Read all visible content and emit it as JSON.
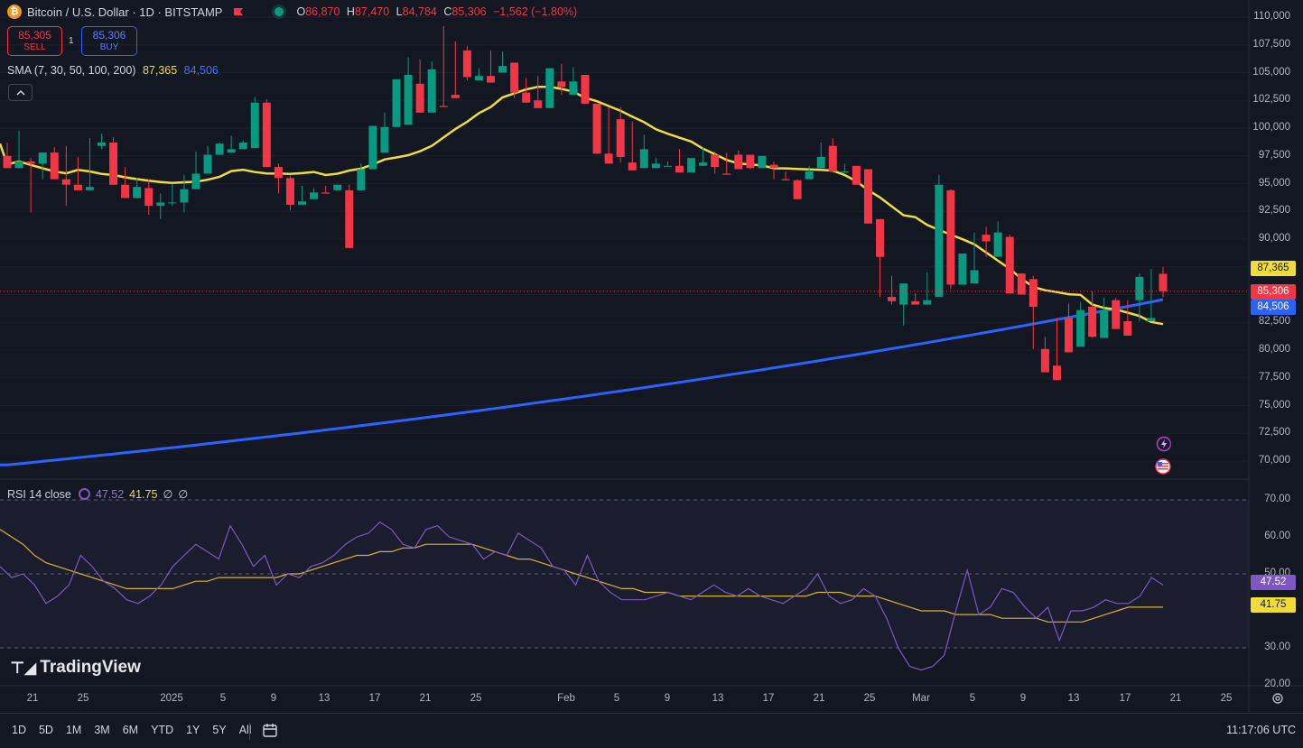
{
  "header": {
    "symbol": "Bitcoin / U.S. Dollar · 1D · BITSTAMP",
    "coin_icon": "₿",
    "ohlc": {
      "o_label": "O",
      "o": "86,870",
      "h_label": "H",
      "h": "87,470",
      "l_label": "L",
      "l": "84,784",
      "c_label": "C",
      "c": "85,306",
      "change": "−1,562 (−1.80%)"
    }
  },
  "trade": {
    "sell_price": "85,305",
    "sell_label": "SELL",
    "buy_price": "85,306",
    "buy_label": "BUY",
    "spread": "1"
  },
  "sma": {
    "label": "SMA (7, 30, 50, 100, 200)",
    "v1": "87,365",
    "v2": "84,506"
  },
  "rsi": {
    "label": "RSI 14 close",
    "v1": "47.52",
    "v2": "41.75",
    "v3": "∅",
    "v4": "∅"
  },
  "colors": {
    "up": "#089981",
    "down": "#f23645",
    "sma_fast": "#f0dc38",
    "sma_slow": "#2962ff",
    "rsi": "#7e57c2",
    "bg": "#131722"
  },
  "price_axis": [
    "110,000",
    "107,500",
    "105,000",
    "102,500",
    "100,000",
    "97,500",
    "95,000",
    "92,500",
    "90,000",
    "87,500",
    "85,000",
    "82,500",
    "80,000",
    "77,500",
    "75,000",
    "72,500",
    "70,000"
  ],
  "price_tags": {
    "sma_fast": "87,365",
    "last": "85,306",
    "sma_slow": "84,506"
  },
  "rsi_axis": [
    "70.00",
    "60.00",
    "50.00",
    "40.00",
    "30.00",
    "20.00"
  ],
  "rsi_tags": {
    "rsi": "47.52",
    "ma": "41.75"
  },
  "time_axis": [
    "21",
    "25",
    "2025",
    "5",
    "9",
    "13",
    "17",
    "21",
    "25",
    "Feb",
    "5",
    "9",
    "13",
    "17",
    "21",
    "25",
    "Mar",
    "5",
    "9",
    "13",
    "17",
    "21",
    "25"
  ],
  "logo_text": "TradingView",
  "ranges": [
    "1D",
    "5D",
    "1M",
    "3M",
    "6M",
    "YTD",
    "1Y",
    "5Y",
    "All"
  ],
  "clock": "11:17:06 UTC",
  "chart_data": {
    "type": "candlestick",
    "y_range": [
      70000,
      110000
    ],
    "candles": [
      [
        97500,
        98700,
        97000,
        96400
      ],
      [
        96400,
        99800,
        96600,
        97000
      ],
      [
        97000,
        97300,
        92400,
        96800
      ],
      [
        96800,
        97500,
        95400,
        97800
      ],
      [
        97800,
        98300,
        95500,
        95400
      ],
      [
        95400,
        98400,
        93000,
        94900
      ],
      [
        94900,
        97400,
        95400,
        94400
      ],
      [
        94400,
        99100,
        98400,
        94700
      ],
      [
        98400,
        99500,
        98100,
        98700
      ],
      [
        98700,
        99200,
        95700,
        94900
      ],
      [
        94900,
        96500,
        94900,
        93700
      ],
      [
        93700,
        95500,
        94600,
        94700
      ],
      [
        94600,
        95400,
        92200,
        93000
      ],
      [
        93000,
        94100,
        91800,
        93300
      ],
      [
        93300,
        95000,
        93000,
        93300
      ],
      [
        93300,
        95800,
        92400,
        94500
      ],
      [
        94500,
        97900,
        94500,
        95900
      ],
      [
        95900,
        98400,
        96400,
        97600
      ],
      [
        97600,
        98700,
        97800,
        98600
      ],
      [
        97800,
        99300,
        98600,
        98100
      ],
      [
        98100,
        98900,
        98200,
        98700
      ],
      [
        98200,
        102800,
        98200,
        102300
      ],
      [
        102300,
        102600,
        96900,
        96500
      ],
      [
        96500,
        96800,
        94100,
        95500
      ],
      [
        95500,
        95800,
        92600,
        93100
      ],
      [
        93100,
        94800,
        93600,
        93400
      ],
      [
        93600,
        94600,
        94600,
        94200
      ],
      [
        94200,
        94800,
        94400,
        94100
      ],
      [
        94400,
        94600,
        94400,
        94900
      ],
      [
        94400,
        94900,
        93000,
        89200
      ],
      [
        94400,
        96800,
        94400,
        96300
      ],
      [
        96300,
        99100,
        97800,
        100200
      ],
      [
        97800,
        101400,
        97800,
        100100
      ],
      [
        100100,
        104200,
        100300,
        104400
      ],
      [
        100300,
        106400,
        104000,
        104800
      ],
      [
        104000,
        106200,
        104800,
        101400
      ],
      [
        101400,
        106000,
        102000,
        105300
      ],
      [
        102000,
        109200,
        103000,
        101900
      ],
      [
        103000,
        107800,
        107000,
        102700
      ],
      [
        107000,
        107400,
        104300,
        104600
      ],
      [
        104300,
        105400,
        104700,
        104700
      ],
      [
        104700,
        107000,
        105000,
        104100
      ],
      [
        105000,
        106900,
        105900,
        105600
      ],
      [
        105900,
        105800,
        102700,
        103200
      ],
      [
        103200,
        104500,
        102500,
        102300
      ],
      [
        102500,
        104700,
        101800,
        101800
      ],
      [
        101800,
        103700,
        104200,
        105400
      ],
      [
        104200,
        105800,
        103000,
        103700
      ],
      [
        103000,
        105500,
        104800,
        104200
      ],
      [
        104800,
        103200,
        103200,
        102200
      ],
      [
        102200,
        100500,
        100500,
        97700
      ],
      [
        97700,
        101900,
        100800,
        96800
      ],
      [
        100800,
        101900,
        96900,
        97400
      ],
      [
        96900,
        100600,
        96400,
        96200
      ],
      [
        96400,
        99400,
        96400,
        98100
      ],
      [
        96400,
        97300,
        96600,
        96800
      ],
      [
        96600,
        97000,
        96600,
        96600
      ],
      [
        96600,
        98100,
        96400,
        96000
      ],
      [
        96000,
        97000,
        96600,
        97300
      ],
      [
        96600,
        98300,
        97600,
        96900
      ],
      [
        97600,
        97900,
        95900,
        96500
      ],
      [
        95900,
        97800,
        97600,
        95800
      ],
      [
        97600,
        98000,
        97600,
        96300
      ],
      [
        97600,
        97500,
        96300,
        96400
      ],
      [
        96400,
        97400,
        96700,
        97500
      ],
      [
        96700,
        97000,
        95400,
        96400
      ],
      [
        95400,
        96100,
        95300,
        95300
      ],
      [
        95300,
        95100,
        95400,
        93600
      ],
      [
        95400,
        96400,
        96600,
        96100
      ],
      [
        96400,
        98700,
        98400,
        97400
      ],
      [
        98400,
        99100,
        96000,
        96100
      ],
      [
        96000,
        96800,
        96600,
        96100
      ],
      [
        96600,
        96300,
        96300,
        94900
      ],
      [
        96300,
        94800,
        91800,
        91400
      ],
      [
        91800,
        88500,
        84800,
        88400
      ],
      [
        84800,
        86700,
        84100,
        84400
      ],
      [
        84100,
        85200,
        82200,
        86000
      ],
      [
        84400,
        85100,
        84100,
        84100
      ],
      [
        84100,
        87000,
        84800,
        84500
      ],
      [
        84800,
        95800,
        94400,
        94900
      ],
      [
        94400,
        94500,
        85500,
        85900
      ],
      [
        85900,
        87400,
        86000,
        88700
      ],
      [
        86000,
        90600,
        90400,
        87200
      ],
      [
        90400,
        91100,
        88400,
        89800
      ],
      [
        88400,
        91600,
        90200,
        90600
      ],
      [
        90200,
        90400,
        86900,
        85100
      ],
      [
        86900,
        85300,
        86400,
        85000
      ],
      [
        86400,
        86700,
        80100,
        83900
      ],
      [
        80100,
        81200,
        78600,
        78000
      ],
      [
        78600,
        82400,
        82900,
        77300
      ],
      [
        82900,
        84200,
        80300,
        79800
      ],
      [
        80300,
        84300,
        83900,
        83600
      ],
      [
        83900,
        85300,
        81100,
        81200
      ],
      [
        81100,
        84700,
        84500,
        83600
      ],
      [
        84500,
        84700,
        82600,
        81900
      ],
      [
        82600,
        84500,
        84500,
        81300
      ],
      [
        84500,
        86900,
        82600,
        86600
      ],
      [
        82600,
        86900,
        87300,
        82900
      ],
      [
        86870,
        87470,
        84784,
        85306
      ]
    ],
    "sma_fast_series": "SMA (fast)",
    "sma_slow_series": "SMA (slow)",
    "rsi_range": [
      20,
      70
    ],
    "rsi_values": [
      52,
      49,
      50,
      47,
      42,
      44,
      47,
      55,
      52,
      48,
      46,
      43,
      42,
      44,
      47,
      52,
      55,
      58,
      56,
      54,
      63,
      58,
      52,
      55,
      47,
      50,
      49,
      52,
      53,
      55,
      58,
      60,
      61,
      64,
      62,
      58,
      57,
      62,
      63,
      60,
      59,
      58,
      54,
      56,
      55,
      61,
      59,
      57,
      52,
      51,
      47,
      55,
      48,
      45,
      43,
      43,
      43,
      44,
      45,
      44,
      43,
      45,
      47,
      45,
      44,
      46,
      44,
      43,
      42,
      44,
      46,
      50,
      44,
      42,
      43,
      46,
      44,
      38,
      30,
      25,
      24,
      25,
      28,
      40,
      51,
      39,
      41,
      46,
      45,
      41,
      38,
      41,
      32,
      40,
      40,
      41,
      43,
      42,
      42,
      44,
      49,
      47
    ],
    "rsi_ma_values": [
      62,
      60,
      58,
      55,
      53,
      52,
      51,
      50,
      49,
      48,
      47,
      46,
      46,
      46,
      46,
      46,
      47,
      48,
      48,
      49,
      49,
      49,
      49,
      49,
      49,
      50,
      50,
      51,
      52,
      53,
      54,
      55,
      55,
      56,
      56,
      57,
      57,
      58,
      58,
      58,
      58,
      58,
      57,
      56,
      55,
      54,
      54,
      53,
      52,
      51,
      50,
      49,
      48,
      47,
      46,
      46,
      45,
      45,
      45,
      44,
      44,
      44,
      44,
      44,
      44,
      44,
      44,
      44,
      44,
      44,
      44,
      45,
      45,
      45,
      44,
      44,
      44,
      43,
      42,
      41,
      40,
      40,
      40,
      39,
      39,
      39,
      39,
      38,
      38,
      38,
      38,
      37,
      37,
      37,
      37,
      38,
      39,
      40,
      41,
      41,
      41,
      41
    ]
  }
}
